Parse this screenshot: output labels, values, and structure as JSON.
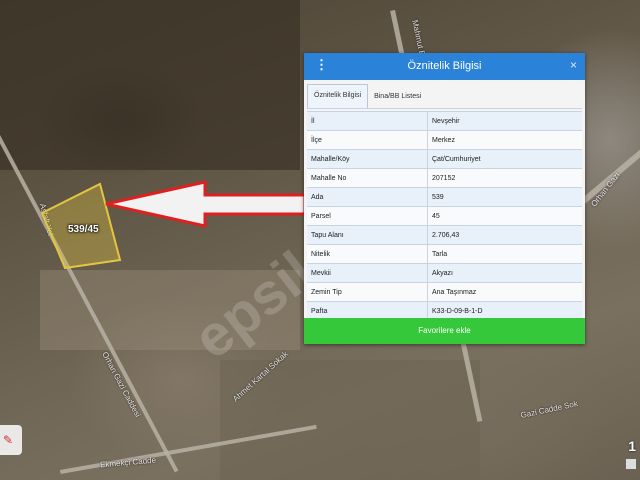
{
  "map": {
    "parcel_label": "539/45",
    "road_labels": [
      "Asfalt Yol",
      "Orhan Gazi Caddesi",
      "Ahmet Kartal Sokak",
      "Mahmut Eşref",
      "Orhan Gazi",
      "Ekmekçi Cadde",
      "Gazi Cadde Sok"
    ],
    "watermark": "epsilon"
  },
  "panel": {
    "title": "Öznitelik Bilgisi",
    "menu_icon": "⋮",
    "close_icon": "×",
    "tabs": [
      "Öznitelik Bilgisi",
      "Bina/BB Listesi"
    ],
    "rows": [
      {
        "key": "İl",
        "value": "Nevşehir"
      },
      {
        "key": "İlçe",
        "value": "Merkez"
      },
      {
        "key": "Mahalle/Köy",
        "value": "Çat/Cumhuriyet"
      },
      {
        "key": "Mahalle No",
        "value": "207152"
      },
      {
        "key": "Ada",
        "value": "539"
      },
      {
        "key": "Parsel",
        "value": "45"
      },
      {
        "key": "Tapu Alanı",
        "value": "2.706,43"
      },
      {
        "key": "Nitelik",
        "value": "Tarla"
      },
      {
        "key": "Mevkii",
        "value": "Akyazı"
      },
      {
        "key": "Zemin Tip",
        "value": "Ana Taşınmaz"
      },
      {
        "key": "Pafta",
        "value": "K33-D-09-B-1-D"
      }
    ],
    "favorite_button": "Favorilere ekle"
  },
  "corner_number": "1",
  "colors": {
    "header": "#2b82d9",
    "button": "#35c83a",
    "arrow": "#e02020",
    "parcel": "#e2c640"
  }
}
